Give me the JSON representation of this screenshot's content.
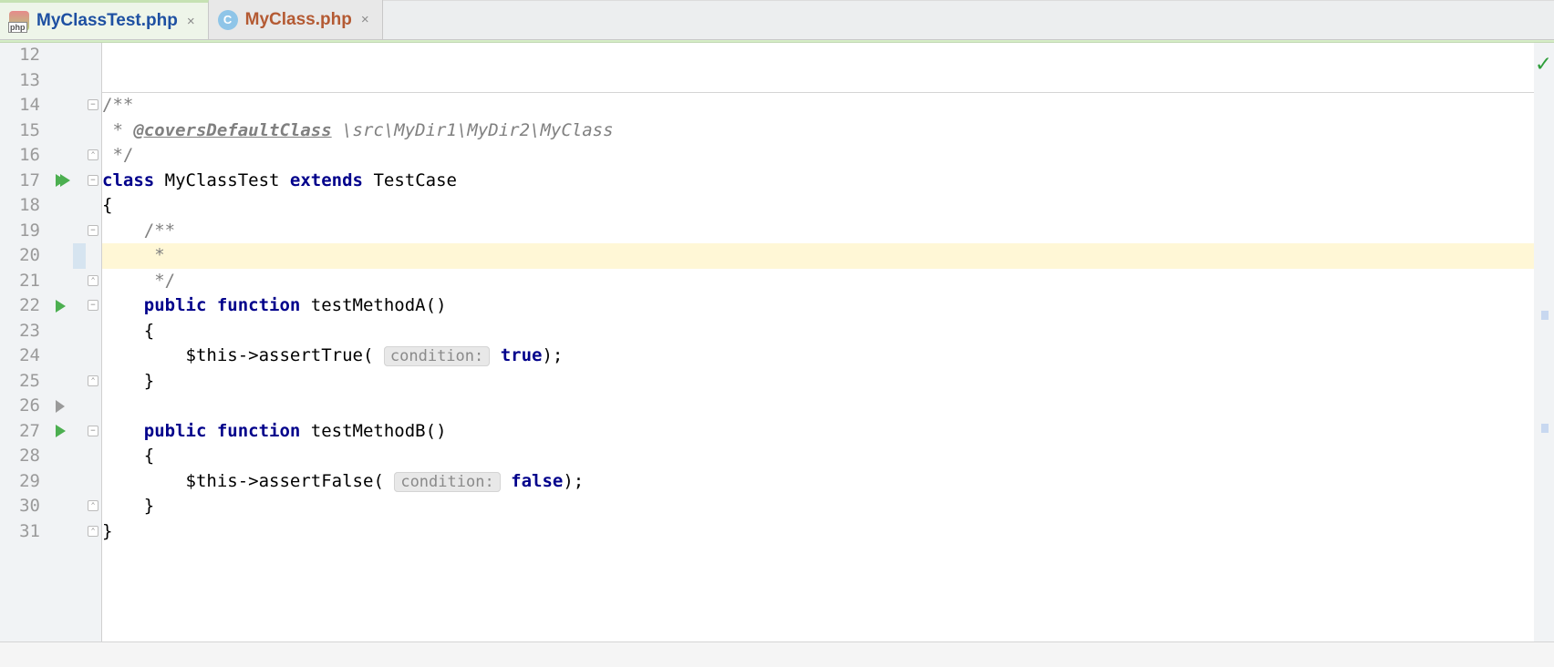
{
  "tabs": [
    {
      "filename": "MyClassTest.php",
      "icon_type": "php",
      "active": true
    },
    {
      "filename": "MyClass.php",
      "icon_type": "c",
      "active": false
    }
  ],
  "line_numbers": [
    "12",
    "13",
    "14",
    "15",
    "16",
    "17",
    "18",
    "19",
    "20",
    "21",
    "22",
    "23",
    "24",
    "25",
    "26",
    "27",
    "28",
    "29",
    "30",
    "31"
  ],
  "caret_line_index": 8,
  "gutter_runs": {
    "5": "fast",
    "10": "run",
    "14": "grey",
    "15": "run"
  },
  "gutter_folds": {
    "2": "minus",
    "4": "up",
    "5": "minus",
    "7": "minus",
    "9": "up",
    "10": "minus",
    "13": "up",
    "15": "minus",
    "18": "up",
    "19": "up"
  },
  "code": {
    "l12": "",
    "l13": "",
    "l14_prefix": "/**",
    "l15_star": " * ",
    "l15_tag": "@coversDefaultClass",
    "l15_path": " \\src\\MyDir1\\MyDir2\\MyClass",
    "l16": " */",
    "l17_class": "class ",
    "l17_name": "MyClassTest ",
    "l17_extends": "extends ",
    "l17_parent": "TestCase",
    "l18": "{",
    "l19": "    /**",
    "l20": "     *",
    "l21": "     */",
    "l22_pub": "    public ",
    "l22_func": "function ",
    "l22_name": "testMethodA()",
    "l23": "    {",
    "l24_this": "        $this",
    "l24_arrow": "->",
    "l24_call": "assertTrue( ",
    "l24_inlay": "condition:",
    "l24_val": " true",
    "l24_end": ");",
    "l25": "    }",
    "l26": "",
    "l27_pub": "    public ",
    "l27_func": "function ",
    "l27_name": "testMethodB()",
    "l28": "    {",
    "l29_this": "        $this",
    "l29_arrow": "->",
    "l29_call": "assertFalse( ",
    "l29_inlay": "condition:",
    "l29_val": " false",
    "l29_end": ");",
    "l30": "    }",
    "l31": "}"
  },
  "status_icon": "✓"
}
